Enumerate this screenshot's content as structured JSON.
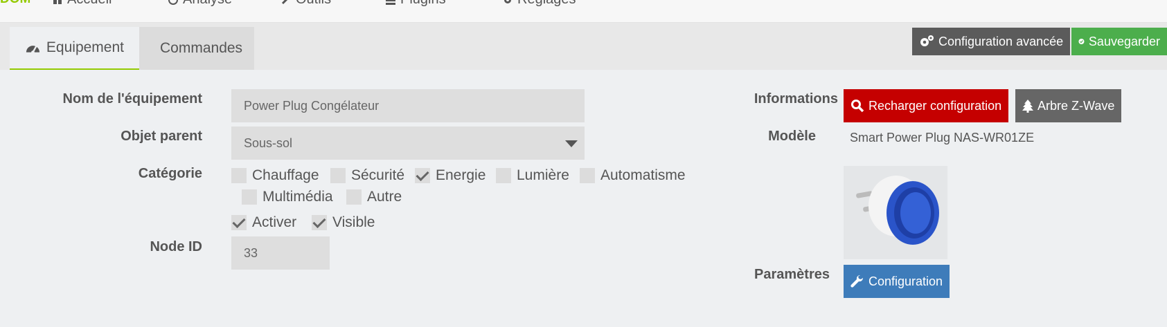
{
  "navbar": {
    "brand": "DOM",
    "items": [
      {
        "label": "Accueil",
        "icon": "home-icon"
      },
      {
        "label": "Analyse",
        "icon": "clock-icon"
      },
      {
        "label": "Outils",
        "icon": "wrench-icon"
      },
      {
        "label": "Plugins",
        "icon": "tasks-icon"
      },
      {
        "label": "Réglages",
        "icon": "cogs-icon"
      }
    ]
  },
  "tabs": [
    {
      "label": "Equipement",
      "icon": "dashboard-icon",
      "active": true
    },
    {
      "label": "Commandes",
      "icon": "list-icon",
      "active": false
    }
  ],
  "toolbar": {
    "advanced_label": "Configuration avancée",
    "save_label": "Sauvegarder"
  },
  "form": {
    "name_label": "Nom de l'équipement",
    "name_value": "Power Plug Congélateur",
    "parent_label": "Objet parent",
    "parent_value": "Sous-sol",
    "category_label": "Catégorie",
    "categories": [
      {
        "label": "Chauffage",
        "checked": false
      },
      {
        "label": "Sécurité",
        "checked": false
      },
      {
        "label": "Energie",
        "checked": true
      },
      {
        "label": "Lumière",
        "checked": false
      },
      {
        "label": "Automatisme",
        "checked": false
      },
      {
        "label": "Multimédia",
        "checked": false
      },
      {
        "label": "Autre",
        "checked": false
      }
    ],
    "activate_label": "Activer",
    "activate_checked": true,
    "visible_label": "Visible",
    "visible_checked": true,
    "node_label": "Node ID",
    "node_value": "33"
  },
  "info": {
    "informations_label": "Informations",
    "reload_label": "Recharger configuration",
    "tree_label": "Arbre Z-Wave",
    "model_label": "Modèle",
    "model_value": "Smart Power Plug NAS-WR01ZE",
    "params_label": "Paramètres",
    "config_label": "Configuration"
  },
  "colors": {
    "accent": "#94ca02",
    "danger": "#c50000",
    "success": "#4cae4c",
    "primary": "#3e7cba",
    "dark_button": "#5b5b5b"
  }
}
